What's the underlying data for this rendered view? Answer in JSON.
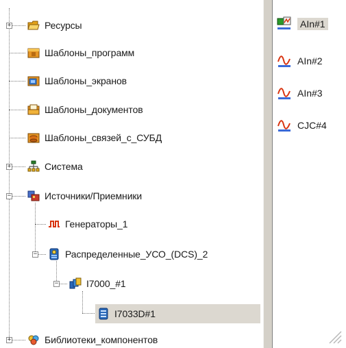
{
  "tree": {
    "items": [
      {
        "label": "Ресурсы",
        "icon": "folder-icon"
      },
      {
        "label": "Шаблоны_программ",
        "icon": "program-template-icon"
      },
      {
        "label": "Шаблоны_экранов",
        "icon": "screen-template-icon"
      },
      {
        "label": "Шаблоны_документов",
        "icon": "document-template-icon"
      },
      {
        "label": "Шаблоны_связей_с_СУБД",
        "icon": "database-link-icon"
      },
      {
        "label": "Система",
        "icon": "network-icon"
      },
      {
        "label": "Источники/Приемники",
        "icon": "sources-icon"
      },
      {
        "label": "Генераторы_1",
        "icon": "generator-icon"
      },
      {
        "label": "Распределенные_УСО_(DCS)_2",
        "icon": "distributed-io-icon"
      },
      {
        "label": "I7000_#1",
        "icon": "module-group-icon"
      },
      {
        "label": "I7033D#1",
        "icon": "module-icon"
      },
      {
        "label": "Библиотеки_компонентов",
        "icon": "library-icon"
      }
    ]
  },
  "channels": {
    "items": [
      {
        "label": "AIn#1",
        "icon": "analog-input-icon",
        "selected": true
      },
      {
        "label": "AIn#2",
        "icon": "signal-wave-icon",
        "selected": false
      },
      {
        "label": "AIn#3",
        "icon": "signal-wave-icon",
        "selected": false
      },
      {
        "label": "CJC#4",
        "icon": "signal-wave-icon",
        "selected": false
      }
    ]
  },
  "colors": {
    "selection": "#dcd8d0",
    "splitter": "#d4d0c8",
    "tree_lines": "#7a7a7a"
  }
}
